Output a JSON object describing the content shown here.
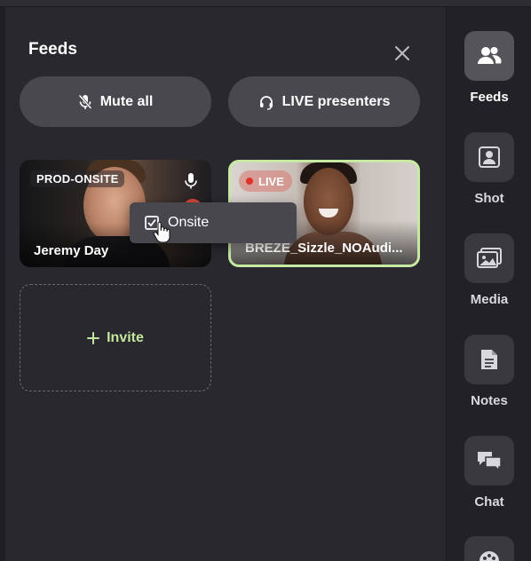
{
  "panel": {
    "title": "Feeds",
    "mute_all_label": "Mute all",
    "live_presenters_label": "LIVE presenters",
    "invite_label": "Invite"
  },
  "feeds": [
    {
      "tag": "PROD-ONSITE",
      "name": "Jeremy Day",
      "icon": "microphone-icon"
    },
    {
      "badge": "LIVE",
      "name": "BREZE_Sizzle_NOAudi...",
      "border_color": "#c7eaa2"
    }
  ],
  "context_menu": {
    "item_label": "Onsite",
    "checked": true
  },
  "sidebar": {
    "items": [
      {
        "label": "Feeds",
        "icon": "people-icon",
        "active": true
      },
      {
        "label": "Shot",
        "icon": "shot-icon",
        "active": false
      },
      {
        "label": "Media",
        "icon": "image-icon",
        "active": false
      },
      {
        "label": "Notes",
        "icon": "document-icon",
        "active": false
      },
      {
        "label": "Chat",
        "icon": "chat-bubbles-icon",
        "active": false
      },
      {
        "label": "",
        "icon": "palette-icon",
        "active": false
      }
    ]
  },
  "colors": {
    "accent_green": "#c5e69d",
    "live_red": "#e0312b",
    "panel_bg": "#29282e"
  }
}
